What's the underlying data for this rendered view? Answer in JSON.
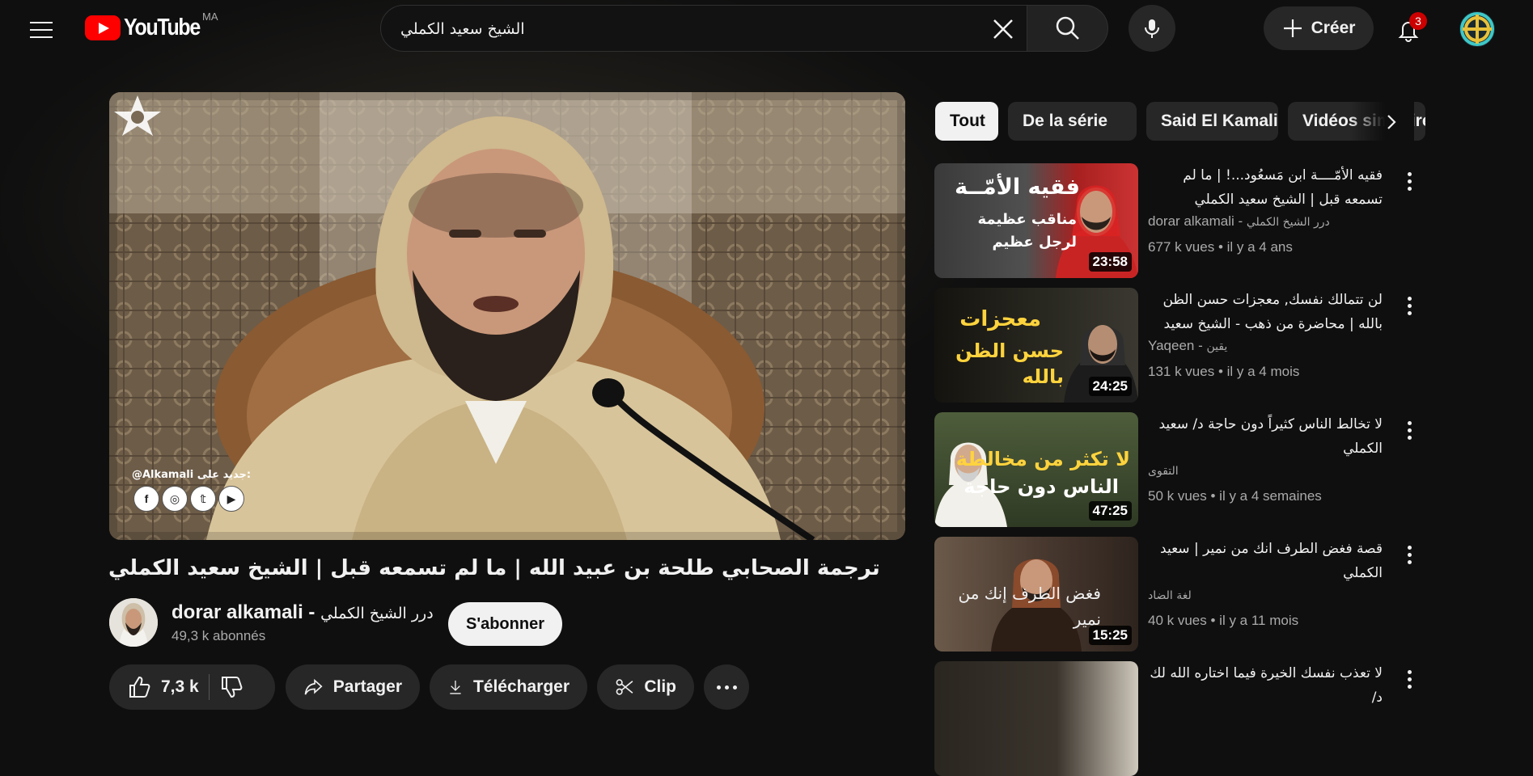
{
  "header": {
    "logo_text": "YouTube",
    "country_code": "MA",
    "search_value": "الشيخ سعيد الكملي",
    "create_label": "Créer",
    "notification_count": "3"
  },
  "player": {
    "watermark_text": "@Alkamali جديد على:",
    "social_icons": [
      "facebook",
      "instagram",
      "twitter",
      "youtube"
    ]
  },
  "video": {
    "title": "ترجمة الصحابي طلحة بن عبيد الله | ما لم تسمعه قبل | الشيخ سعيد الكملي",
    "channel_name": "dorar alkamali - ",
    "channel_name_ar": "درر الشيخ الكملي",
    "subscribers": "49,3 k abonnés",
    "subscribe_label": "S'abonner",
    "like_count": "7,3 k",
    "share_label": "Partager",
    "download_label": "Télécharger",
    "clip_label": "Clip"
  },
  "chips": [
    "Tout",
    "De la série",
    "Said El Kamali",
    "Vidéos similaires"
  ],
  "recommendations": [
    {
      "title": "فقيه الأمّــــة ابن مَسعُود...! | ما لم تسمعه قبل | الشيخ سعيد الكملي",
      "channel": "dorar alkamali - ",
      "channel_ar": "درر الشيخ الكملي",
      "meta": "677 k vues • il y a 4 ans",
      "duration": "23:58",
      "thumb_line1": "فقيه الأمّــة",
      "thumb_line2": "مناقب عظيمة\nلرجل عظيم",
      "thumb_color": "#b02020"
    },
    {
      "title": "لن تتمالك نفسك, معجزات حسن الظن بالله | محاضرة من ذهب - الشيخ سعيد الكملي",
      "channel": "Yaqeen - ",
      "channel_ar": "يقين",
      "meta": "131 k vues • il y a 4 mois",
      "duration": "24:25",
      "thumb_line1": "معجزات",
      "thumb_line2": "حسن الظن بالله",
      "thumb_color": "#2a2a22"
    },
    {
      "title": "لا تخالط الناس كثيراً دون حاجة د/ سعيد الكملي",
      "channel": "",
      "channel_ar": "التقوى",
      "meta": "50 k vues • il y a 4 semaines",
      "duration": "47:25",
      "thumb_line1": "لا تكثر من مخالطة",
      "thumb_line2": "الناس دون حاجة",
      "thumb_color": "#3b4a2c"
    },
    {
      "title": "قصة فغض الطرف انك من نمير | سعيد الكملي",
      "channel": "",
      "channel_ar": "لغة الضاد",
      "meta": "40 k vues • il y a 11 mois",
      "duration": "15:25",
      "thumb_line1": "",
      "thumb_line2": "فغض الطرف إنك من نمير",
      "thumb_color": "#4a3a30"
    },
    {
      "title": "لا تعذب نفسك الخيرة فيما اختاره الله لك د/",
      "channel": "",
      "channel_ar": "",
      "meta": "",
      "duration": "",
      "thumb_line1": "",
      "thumb_line2": "",
      "thumb_color": "#2a2620"
    }
  ],
  "colors": {
    "background": "#0f0f0f",
    "surface": "#272727",
    "text": "#f1f1f1",
    "muted": "#aaaaaa",
    "brand_red": "#ff0000",
    "thumb_yellow": "#ffd33d"
  }
}
